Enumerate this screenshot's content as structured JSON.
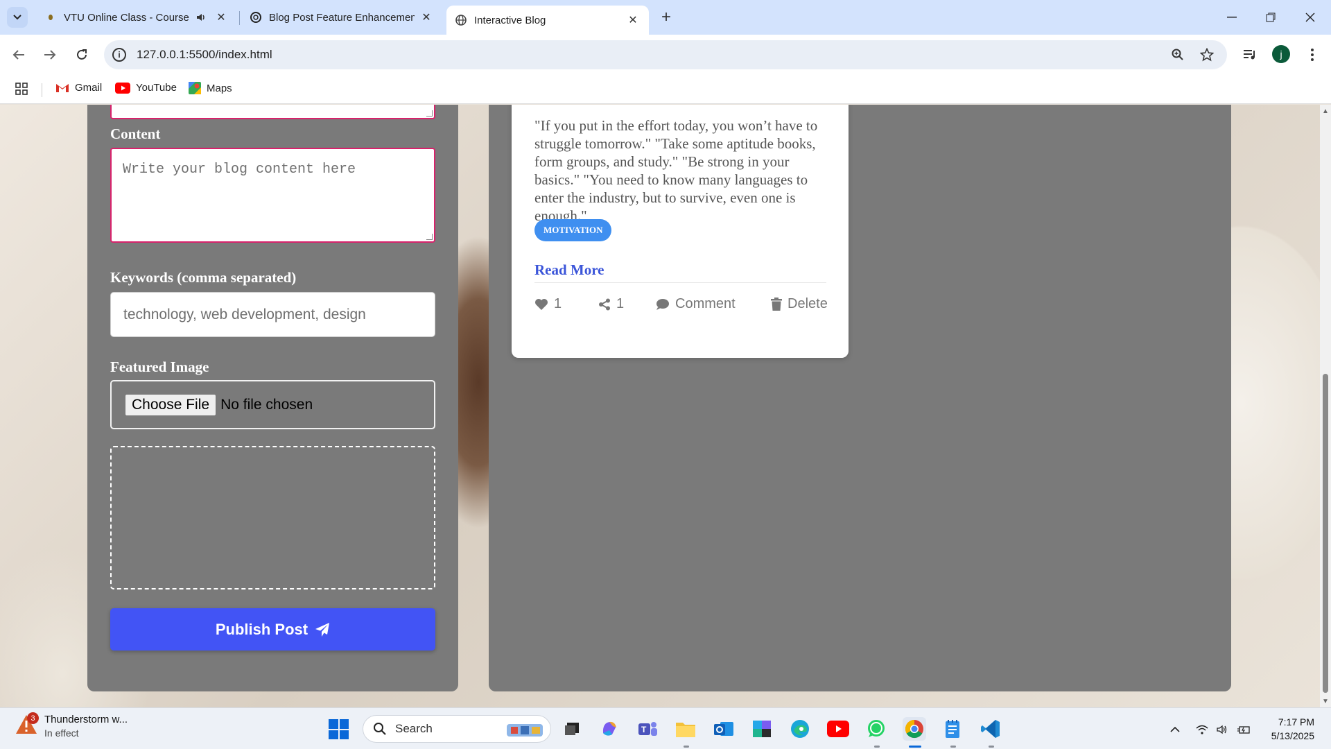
{
  "browser": {
    "tabs": [
      {
        "title": "VTU Online Class - Course I",
        "audio": true
      },
      {
        "title": "Blog Post Feature Enhancement"
      },
      {
        "title": "Interactive Blog",
        "active": true
      }
    ],
    "url": "127.0.0.1:5500/index.html",
    "profile_initial": "j",
    "bookmarks": [
      "Gmail",
      "YouTube",
      "Maps"
    ]
  },
  "form": {
    "content_label": "Content",
    "content_placeholder": "Write your blog content here",
    "keywords_label": "Keywords (comma separated)",
    "keywords_placeholder": "technology, web development, design",
    "image_label": "Featured Image",
    "choose_file": "Choose File",
    "no_file": "No file chosen",
    "publish": "Publish Post"
  },
  "post": {
    "text": "\"If you put in the effort today, you won’t have to struggle tomorrow.\" \"Take some aptitude books, form groups, and study.\" \"Be strong in your basics.\" \"You need to know many languages to enter the industry, but to survive, even one is enough.\"",
    "tag": "MOTIVATION",
    "read_more": "Read More",
    "likes": "1",
    "shares": "1",
    "comment": "Comment",
    "delete": "Delete"
  },
  "taskbar": {
    "weather_title": "Thunderstorm w...",
    "weather_sub": "In effect",
    "weather_badge": "3",
    "search": "Search",
    "time": "7:17 PM",
    "date": "5/13/2025"
  },
  "colors": {
    "accent_pink": "#d8226b",
    "publish_blue": "#4254f5",
    "tag_blue": "#3f8ff0",
    "panel_gray": "#7a7a7a"
  }
}
